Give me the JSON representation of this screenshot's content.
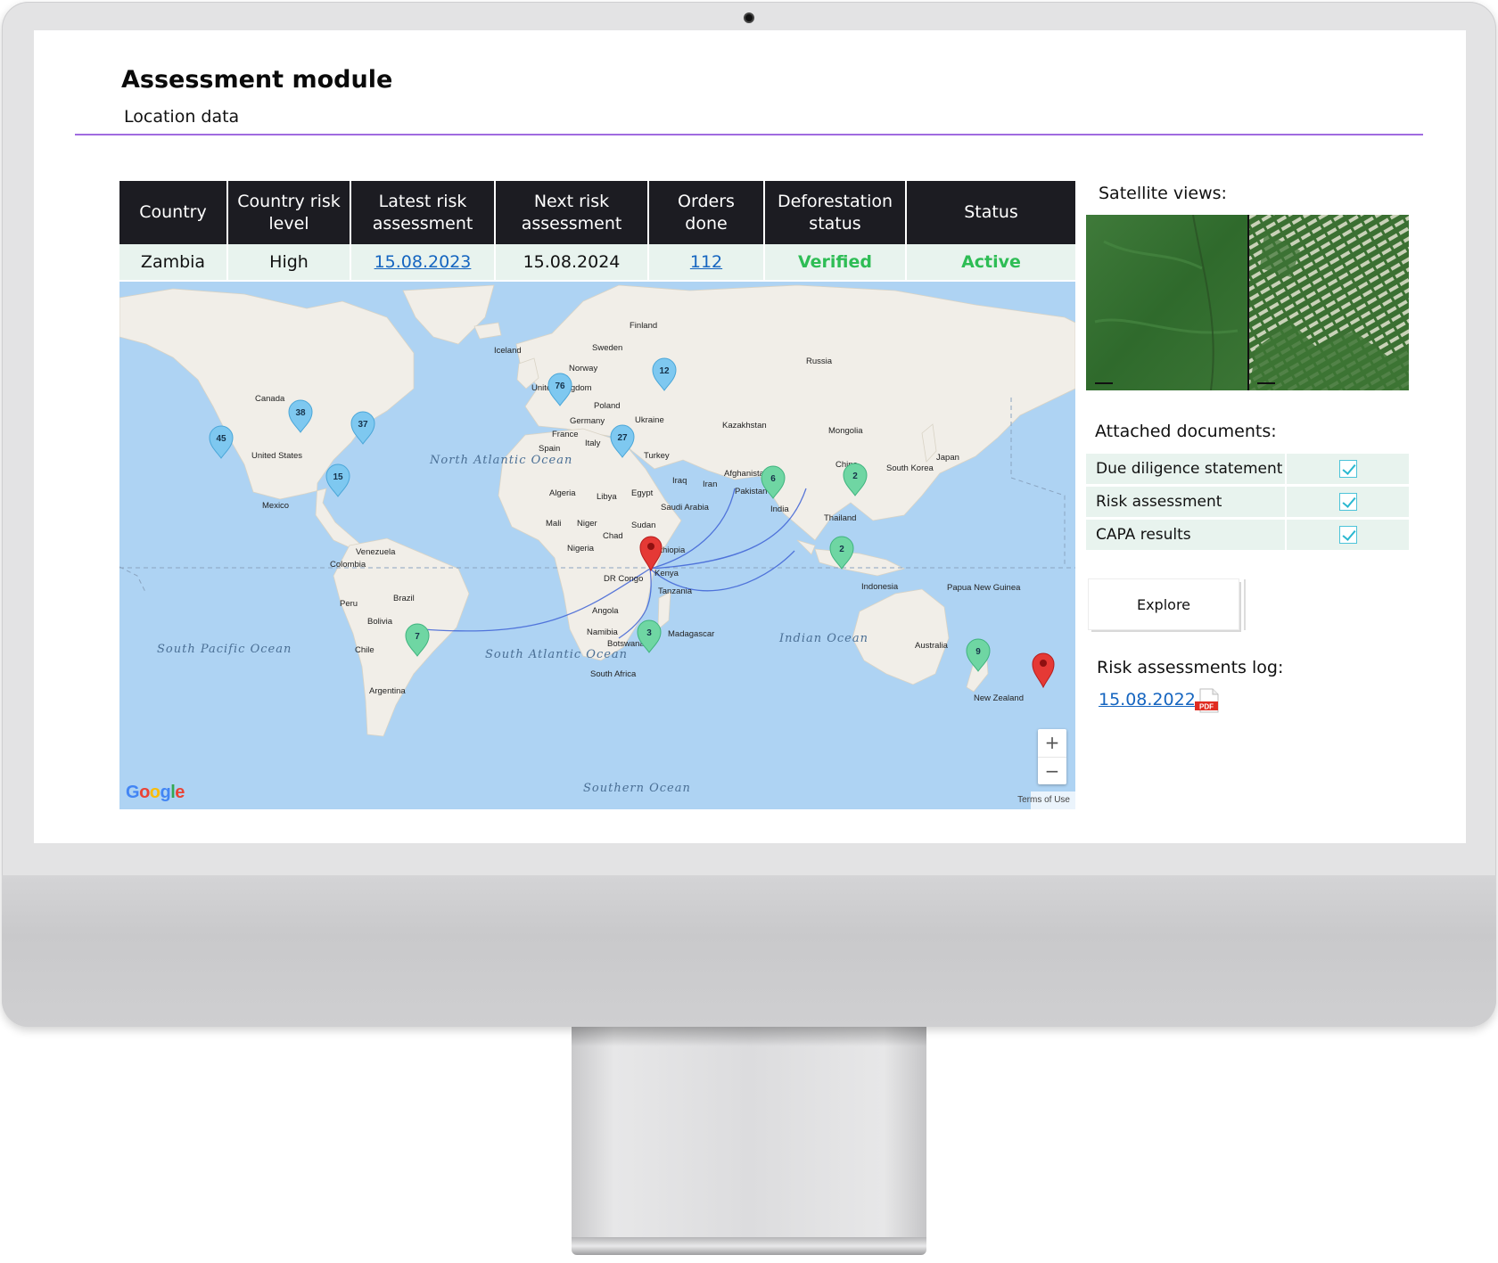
{
  "page": {
    "title": "Assessment module",
    "subtitle": "Location data"
  },
  "table": {
    "headers": [
      "Country",
      "Country risk level",
      "Latest risk assessment",
      "Next risk assessment",
      "Orders done",
      "Deforestation status",
      "Status"
    ],
    "row": {
      "country": "Zambia",
      "risk_level": "High",
      "latest_assessment": "15.08.2023",
      "next_assessment": "15.08.2024",
      "orders_done": "112",
      "deforestation_status": "Verified",
      "status": "Active"
    }
  },
  "map": {
    "provider": "Google",
    "terms_label": "Terms of Use",
    "zoom_in": "+",
    "zoom_out": "−",
    "clusters": [
      {
        "count": "45",
        "color": "#7ec8f0"
      },
      {
        "count": "38",
        "color": "#7ec8f0"
      },
      {
        "count": "37",
        "color": "#7ec8f0"
      },
      {
        "count": "15",
        "color": "#7ec8f0"
      },
      {
        "count": "76",
        "color": "#7ec8f0"
      },
      {
        "count": "12",
        "color": "#7ec8f0"
      },
      {
        "count": "27",
        "color": "#7ec8f0"
      },
      {
        "count": "6",
        "color": "#6fd6a3"
      },
      {
        "count": "2",
        "color": "#6fd6a3"
      },
      {
        "count": "2",
        "color": "#6fd6a3"
      },
      {
        "count": "7",
        "color": "#6fd6a3"
      },
      {
        "count": "3",
        "color": "#6fd6a3"
      },
      {
        "count": "9",
        "color": "#6fd6a3"
      }
    ],
    "place_labels": [
      "Finland",
      "Sweden",
      "Iceland",
      "Norway",
      "Russia",
      "United Kingdom",
      "Poland",
      "Germany",
      "Ukraine",
      "Kazakhstan",
      "Mongolia",
      "Canada",
      "France",
      "Italy",
      "Spain",
      "Turkey",
      "United States",
      "Japan",
      "South Korea",
      "China",
      "Afghanistan",
      "Iraq",
      "Iran",
      "Pakistan",
      "Algeria",
      "Libya",
      "Egypt",
      "Saudi Arabia",
      "India",
      "Mexico",
      "Mali",
      "Niger",
      "Sudan",
      "Chad",
      "Thailand",
      "Nigeria",
      "Ethiopia",
      "Venezuela",
      "Colombia",
      "Kenya",
      "DR Congo",
      "Indonesia",
      "Tanzania",
      "Papua New Guinea",
      "Peru",
      "Brazil",
      "Angola",
      "Bolivia",
      "Namibia",
      "Botswana",
      "Madagascar",
      "Australia",
      "Chile",
      "South Africa",
      "Argentina",
      "New Zealand"
    ],
    "ocean_labels": [
      "North Atlantic Ocean",
      "South Atlantic Ocean",
      "Indian Ocean",
      "South Pacific Ocean",
      "Southern Ocean"
    ],
    "accent_pin_color": "#e53935",
    "route_color": "#3f63d6"
  },
  "side_panel": {
    "satellite_label": "Satellite views:",
    "documents_label": "Attached documents:",
    "documents": [
      {
        "name": "Due diligence statement",
        "checked": true
      },
      {
        "name": "Risk assessment",
        "checked": true
      },
      {
        "name": "CAPA results",
        "checked": true
      }
    ],
    "explore_label": "Explore",
    "log_label": "Risk assessments log:",
    "log_entry": "15.08.2022",
    "pdf_badge": "PDF"
  },
  "colors": {
    "header_bg": "#1c1c22",
    "row_bg": "#e8f3ee",
    "link": "#1565c0",
    "success": "#2ebd55",
    "title_rule": "#a06be0"
  }
}
